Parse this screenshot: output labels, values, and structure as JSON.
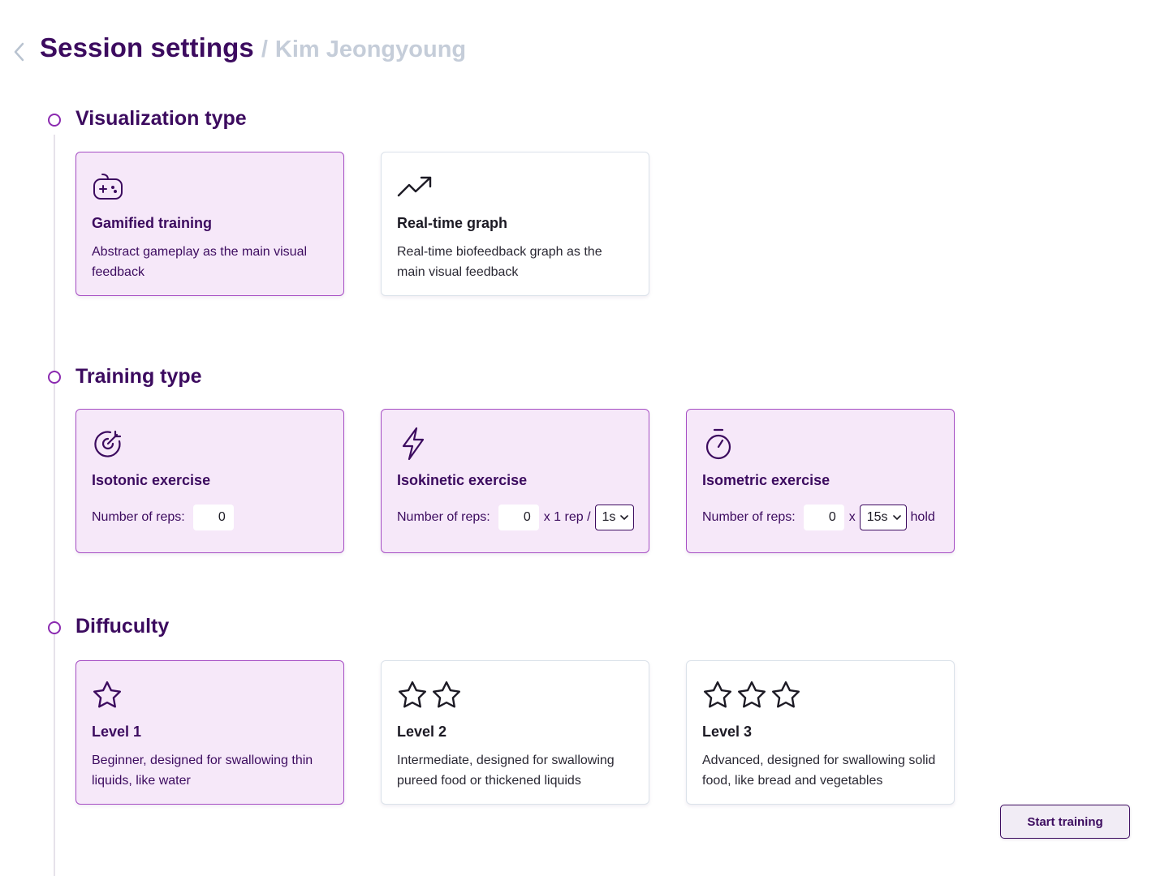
{
  "header": {
    "back_icon": "chevron-left-icon",
    "title": "Session settings",
    "separator": "/",
    "patient_name": "Kim Jeongyoung"
  },
  "sections": {
    "visualization": {
      "title": "Visualization type",
      "options": [
        {
          "icon": "gamepad-icon",
          "title": "Gamified training",
          "description": "Abstract gameplay as the main visual feedback",
          "selected": true
        },
        {
          "icon": "trending-up-icon",
          "title": "Real-time graph",
          "description": "Real-time biofeedback graph as the main visual feedback",
          "selected": false
        }
      ]
    },
    "training": {
      "title": "Training type",
      "options": [
        {
          "icon": "target-icon",
          "title": "Isotonic exercise",
          "reps_label": "Number of reps:",
          "reps_value": "0",
          "selected": true
        },
        {
          "icon": "lightning-icon",
          "title": "Isokinetic exercise",
          "reps_label": "Number of reps:",
          "reps_value": "0",
          "multiplier": "x 1 rep /",
          "duration_value": "1s",
          "selected": true
        },
        {
          "icon": "stopwatch-icon",
          "title": "Isometric exercise",
          "reps_label": "Number of reps:",
          "reps_value": "0",
          "multiplier": "x",
          "duration_value": "15s",
          "suffix": "hold",
          "selected": true
        }
      ]
    },
    "difficulty": {
      "title": "Diffuculty",
      "options": [
        {
          "icon": "star-icon",
          "stars": 1,
          "title": "Level 1",
          "description": "Beginner, designed for swallowing thin liquids, like water",
          "selected": true
        },
        {
          "icon": "star-icon",
          "stars": 2,
          "title": "Level 2",
          "description": "Intermediate, designed for swallowing pureed food or thickened liquids",
          "selected": false
        },
        {
          "icon": "star-icon",
          "stars": 3,
          "title": "Level 3",
          "description": "Advanced, designed for swallowing solid food, like bread and vegetables",
          "selected": false
        }
      ]
    }
  },
  "actions": {
    "start_label": "Start training"
  },
  "colors": {
    "primary": "#3c0b5f",
    "accent": "#a64ec4",
    "selected_bg": "#f6e8f9",
    "muted_text": "#c5cdd9"
  }
}
